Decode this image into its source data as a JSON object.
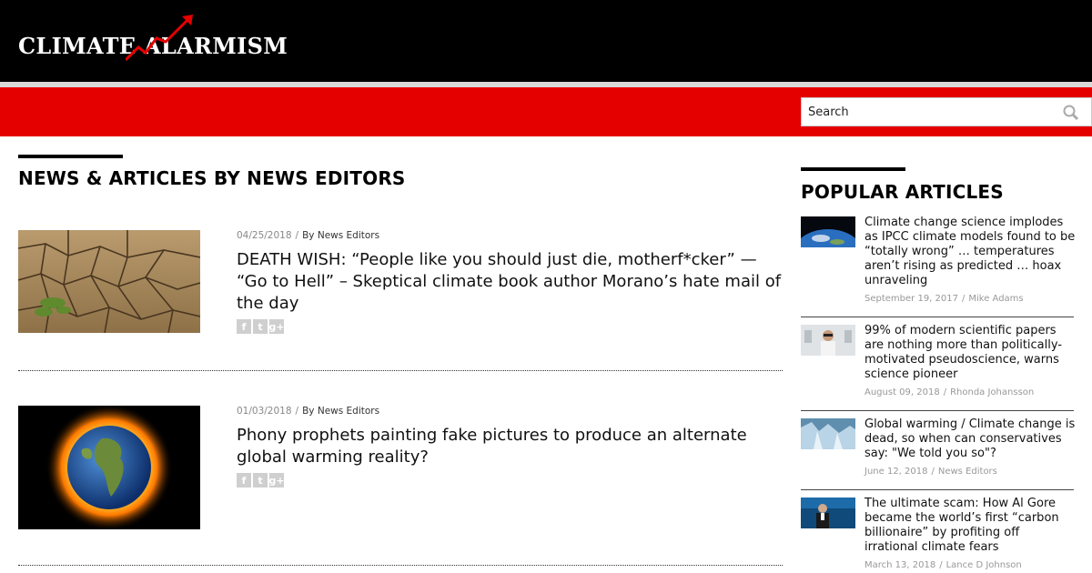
{
  "site": {
    "logo_text": "CLIMATE ALARMISM",
    "logo_accent_color": "#e50000"
  },
  "search": {
    "placeholder": "Search",
    "icon": "search-icon"
  },
  "main": {
    "section_title": "NEWS & ARTICLES BY NEWS EDITORS",
    "articles": [
      {
        "date": "04/25/2018",
        "author": "By News Editors",
        "title": "DEATH WISH: “People like you should just die, motherf*cker” — “Go to Hell” – Skeptical climate book author Morano’s hate mail of the day",
        "image": "cracked-dry-earth-image",
        "social": [
          "f",
          "t",
          "g+"
        ]
      },
      {
        "date": "01/03/2018",
        "author": "By News Editors",
        "title": "Phony prophets painting fake pictures to produce an alternate global warming reality?",
        "image": "burning-earth-image",
        "social": [
          "f",
          "t",
          "g+"
        ]
      }
    ]
  },
  "sidebar": {
    "section_title": "POPULAR ARTICLES",
    "items": [
      {
        "title": "Climate change science implodes as IPCC climate models found to be “totally wrong” … temperatures aren’t rising as predicted … hoax unraveling",
        "date": "September 19, 2017",
        "author": "Mike Adams",
        "image": "earth-from-space-thumb"
      },
      {
        "title": "99% of modern scientific papers are nothing more than politically-motivated pseudoscience, warns science pioneer",
        "date": "August 09, 2018",
        "author": "Rhonda Johansson",
        "image": "scientist-thumb"
      },
      {
        "title": "Global warming / Climate change is dead, so when can conservatives say: \"We told you so\"?",
        "date": "June 12, 2018",
        "author": "News Editors",
        "image": "glacier-thumb"
      },
      {
        "title": "The ultimate scam: How Al Gore became the world’s first “carbon billionaire” by profiting off irrational climate fears",
        "date": "March 13, 2018",
        "author": "Lance D Johnson",
        "image": "speaker-thumb"
      }
    ]
  }
}
